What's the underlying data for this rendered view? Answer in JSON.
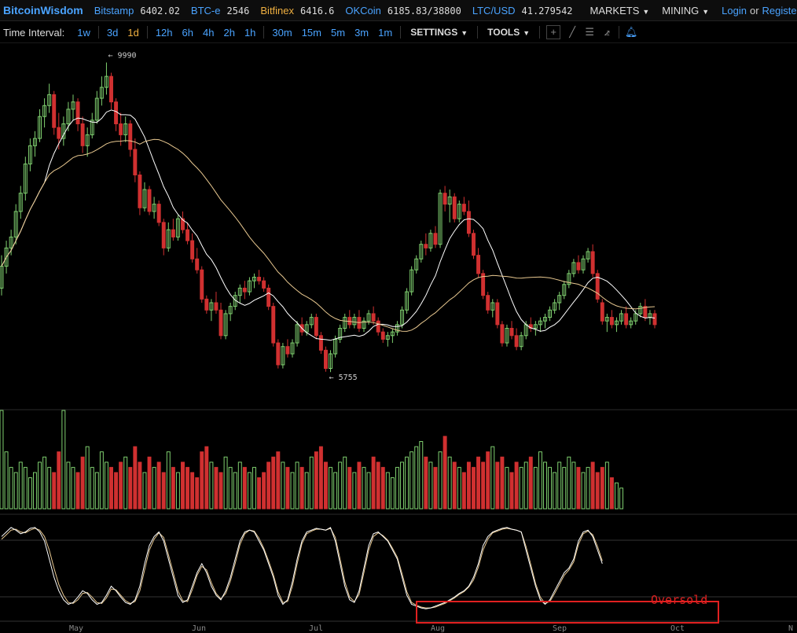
{
  "header": {
    "brand": "BitcoinWisdom",
    "exchanges": [
      {
        "name": "Bitstamp",
        "price": "6402.02",
        "highlight": false
      },
      {
        "name": "BTC-e",
        "price": "2546",
        "highlight": false
      },
      {
        "name": "Bitfinex",
        "price": "6416.6",
        "highlight": true
      },
      {
        "name": "OKCoin",
        "price": "6185.83/38800",
        "highlight": false
      },
      {
        "name": "LTC/USD",
        "price": "41.279542",
        "highlight": false
      }
    ],
    "markets_label": "MARKETS",
    "mining_label": "MINING",
    "login_label": "Login",
    "or_label": "or",
    "register_label": "Register"
  },
  "toolbar": {
    "time_interval_label": "Time Interval:",
    "intervals": [
      {
        "label": "1w",
        "active": false
      },
      {
        "label": "3d",
        "active": false
      },
      {
        "label": "1d",
        "active": true
      },
      {
        "label": "12h",
        "active": false
      },
      {
        "label": "6h",
        "active": false
      },
      {
        "label": "4h",
        "active": false
      },
      {
        "label": "2h",
        "active": false
      },
      {
        "label": "1h",
        "active": false
      },
      {
        "label": "30m",
        "active": false
      },
      {
        "label": "15m",
        "active": false
      },
      {
        "label": "5m",
        "active": false
      },
      {
        "label": "3m",
        "active": false
      },
      {
        "label": "1m",
        "active": false
      }
    ],
    "settings_label": "SETTINGS",
    "tools_label": "TOOLS",
    "tool_icons": [
      "crosshair-icon",
      "line-icon",
      "horizontal-lines-icon",
      "fan-icon",
      "alert-bell-icon"
    ]
  },
  "chart_data": {
    "type": "candlestick",
    "x_tick_labels": [
      "May",
      "Jun",
      "Jul",
      "Aug",
      "Sep",
      "Oct",
      "N"
    ],
    "annotations": {
      "high": "← 9990",
      "low": "← 5755",
      "oversold": "Oversold"
    },
    "price_range": [
      5300,
      10200
    ],
    "high_value": 9990,
    "low_value": 5755,
    "colors": {
      "up": "#7fcf6f",
      "down": "#d03030",
      "ma_fast": "#ffffff",
      "ma_slow": "#e8c890",
      "box": "#e02020"
    },
    "candles_ohlc": [
      [
        6900,
        7350,
        6800,
        7200
      ],
      [
        7200,
        7550,
        7100,
        7450
      ],
      [
        7450,
        7700,
        7350,
        7600
      ],
      [
        7600,
        8050,
        7500,
        7950
      ],
      [
        7950,
        8300,
        7850,
        8200
      ],
      [
        8200,
        8700,
        8100,
        8600
      ],
      [
        8600,
        8950,
        8500,
        8850
      ],
      [
        8850,
        9050,
        8700,
        8950
      ],
      [
        8950,
        9350,
        8900,
        9250
      ],
      [
        9250,
        9500,
        9100,
        9400
      ],
      [
        9400,
        9700,
        9300,
        9550
      ],
      [
        9550,
        9600,
        9000,
        9100
      ],
      [
        9100,
        9300,
        8800,
        8950
      ],
      [
        8950,
        9250,
        8850,
        9150
      ],
      [
        9150,
        9450,
        9050,
        9350
      ],
      [
        9350,
        9550,
        9200,
        9450
      ],
      [
        9450,
        9500,
        9050,
        9150
      ],
      [
        9150,
        9250,
        8750,
        8850
      ],
      [
        8850,
        9100,
        8700,
        9000
      ],
      [
        9000,
        9300,
        8950,
        9200
      ],
      [
        9200,
        9600,
        9150,
        9500
      ],
      [
        9500,
        9800,
        9400,
        9650
      ],
      [
        9650,
        9990,
        9550,
        9800
      ],
      [
        9800,
        9850,
        9350,
        9450
      ],
      [
        9450,
        9500,
        9050,
        9150
      ],
      [
        9150,
        9300,
        8850,
        9000
      ],
      [
        9000,
        9250,
        8900,
        9150
      ],
      [
        9150,
        9200,
        8700,
        8800
      ],
      [
        8800,
        8950,
        8350,
        8450
      ],
      [
        8450,
        8500,
        7900,
        8000
      ],
      [
        8000,
        8350,
        7950,
        8250
      ],
      [
        8250,
        8300,
        7900,
        7950
      ],
      [
        7950,
        8150,
        7850,
        8050
      ],
      [
        8050,
        8100,
        7750,
        7800
      ],
      [
        7800,
        7850,
        7350,
        7450
      ],
      [
        7450,
        7800,
        7400,
        7700
      ],
      [
        7700,
        7850,
        7550,
        7600
      ],
      [
        7600,
        7900,
        7550,
        7850
      ],
      [
        7850,
        7950,
        7650,
        7700
      ],
      [
        7700,
        7800,
        7500,
        7550
      ],
      [
        7550,
        7650,
        7250,
        7300
      ],
      [
        7300,
        7450,
        7100,
        7150
      ],
      [
        7150,
        7200,
        6700,
        6750
      ],
      [
        6750,
        6800,
        6550,
        6600
      ],
      [
        6600,
        6750,
        6450,
        6700
      ],
      [
        6700,
        6850,
        6550,
        6600
      ],
      [
        6600,
        6700,
        6200,
        6250
      ],
      [
        6250,
        6600,
        6200,
        6550
      ],
      [
        6550,
        6700,
        6450,
        6650
      ],
      [
        6650,
        6850,
        6600,
        6800
      ],
      [
        6800,
        6950,
        6700,
        6900
      ],
      [
        6900,
        7000,
        6750,
        6850
      ],
      [
        6850,
        7050,
        6800,
        7000
      ],
      [
        7000,
        7100,
        6900,
        7050
      ],
      [
        7050,
        7150,
        6950,
        7000
      ],
      [
        7000,
        7050,
        6850,
        6900
      ],
      [
        6900,
        6950,
        6600,
        6650
      ],
      [
        6650,
        6700,
        6100,
        6150
      ],
      [
        6150,
        6200,
        5800,
        5850
      ],
      [
        5850,
        6150,
        5800,
        6100
      ],
      [
        6100,
        6200,
        5950,
        6000
      ],
      [
        6000,
        6200,
        5950,
        6150
      ],
      [
        6150,
        6450,
        6100,
        6400
      ],
      [
        6400,
        6500,
        6250,
        6300
      ],
      [
        6300,
        6450,
        6250,
        6400
      ],
      [
        6400,
        6550,
        6350,
        6500
      ],
      [
        6500,
        6550,
        6200,
        6250
      ],
      [
        6250,
        6300,
        6000,
        6050
      ],
      [
        6050,
        6100,
        5755,
        5800
      ],
      [
        5800,
        6050,
        5750,
        6000
      ],
      [
        6000,
        6250,
        5950,
        6200
      ],
      [
        6200,
        6400,
        6150,
        6350
      ],
      [
        6350,
        6550,
        6300,
        6500
      ],
      [
        6500,
        6600,
        6350,
        6400
      ],
      [
        6400,
        6550,
        6350,
        6500
      ],
      [
        6500,
        6600,
        6300,
        6350
      ],
      [
        6350,
        6500,
        6300,
        6450
      ],
      [
        6450,
        6600,
        6400,
        6550
      ],
      [
        6550,
        6650,
        6400,
        6450
      ],
      [
        6450,
        6500,
        6250,
        6300
      ],
      [
        6300,
        6350,
        6150,
        6200
      ],
      [
        6200,
        6300,
        6100,
        6250
      ],
      [
        6250,
        6350,
        6150,
        6300
      ],
      [
        6300,
        6450,
        6250,
        6400
      ],
      [
        6400,
        6650,
        6350,
        6600
      ],
      [
        6600,
        6900,
        6550,
        6850
      ],
      [
        6850,
        7200,
        6800,
        7150
      ],
      [
        7150,
        7350,
        7100,
        7300
      ],
      [
        7300,
        7550,
        7250,
        7500
      ],
      [
        7500,
        7650,
        7350,
        7450
      ],
      [
        7450,
        7700,
        7400,
        7650
      ],
      [
        7650,
        7750,
        7450,
        7500
      ],
      [
        7500,
        8250,
        7450,
        8200
      ],
      [
        8200,
        8300,
        7950,
        8050
      ],
      [
        8050,
        8250,
        7800,
        8150
      ],
      [
        8150,
        8200,
        7800,
        7850
      ],
      [
        7850,
        8100,
        7800,
        8050
      ],
      [
        8050,
        8150,
        7900,
        7950
      ],
      [
        7950,
        8100,
        7600,
        7650
      ],
      [
        7650,
        7700,
        7300,
        7350
      ],
      [
        7350,
        7450,
        7050,
        7100
      ],
      [
        7100,
        7150,
        6750,
        6800
      ],
      [
        6800,
        6850,
        6550,
        6600
      ],
      [
        6600,
        6750,
        6500,
        6700
      ],
      [
        6700,
        6750,
        6350,
        6400
      ],
      [
        6400,
        6450,
        6100,
        6150
      ],
      [
        6150,
        6400,
        6100,
        6350
      ],
      [
        6350,
        6450,
        6200,
        6250
      ],
      [
        6250,
        6350,
        6050,
        6100
      ],
      [
        6100,
        6300,
        6050,
        6250
      ],
      [
        6250,
        6450,
        6200,
        6400
      ],
      [
        6400,
        6500,
        6300,
        6350
      ],
      [
        6350,
        6450,
        6250,
        6400
      ],
      [
        6400,
        6500,
        6300,
        6450
      ],
      [
        6450,
        6550,
        6350,
        6500
      ],
      [
        6500,
        6650,
        6450,
        6600
      ],
      [
        6600,
        6750,
        6550,
        6700
      ],
      [
        6700,
        6850,
        6600,
        6800
      ],
      [
        6800,
        7000,
        6750,
        6950
      ],
      [
        6950,
        7150,
        6900,
        7100
      ],
      [
        7100,
        7300,
        7050,
        7250
      ],
      [
        7250,
        7350,
        7100,
        7150
      ],
      [
        7150,
        7350,
        7100,
        7300
      ],
      [
        7300,
        7450,
        7250,
        7400
      ],
      [
        7400,
        7500,
        7050,
        7100
      ],
      [
        7100,
        7150,
        6700,
        6750
      ],
      [
        6700,
        6750,
        6400,
        6450
      ],
      [
        6450,
        6550,
        6300,
        6500
      ],
      [
        6500,
        6600,
        6350,
        6400
      ],
      [
        6400,
        6500,
        6300,
        6450
      ],
      [
        6450,
        6600,
        6400,
        6550
      ],
      [
        6550,
        6650,
        6350,
        6400
      ],
      [
        6400,
        6500,
        6350,
        6450
      ],
      [
        6450,
        6600,
        6400,
        6550
      ],
      [
        6550,
        6700,
        6500,
        6650
      ],
      [
        6650,
        6750,
        6450,
        6500
      ],
      [
        6500,
        6600,
        6400,
        6550
      ],
      [
        6550,
        6600,
        6350,
        6400
      ]
    ],
    "volume": [
      95,
      55,
      40,
      35,
      45,
      40,
      30,
      35,
      45,
      50,
      40,
      35,
      55,
      95,
      45,
      40,
      35,
      50,
      60,
      40,
      35,
      55,
      45,
      40,
      35,
      45,
      50,
      40,
      60,
      45,
      35,
      50,
      40,
      45,
      35,
      55,
      40,
      35,
      45,
      40,
      35,
      30,
      55,
      60,
      45,
      40,
      35,
      50,
      40,
      35,
      45,
      40,
      35,
      40,
      30,
      35,
      45,
      50,
      55,
      45,
      40,
      35,
      45,
      40,
      35,
      50,
      55,
      60,
      45,
      40,
      35,
      45,
      50,
      40,
      35,
      45,
      40,
      35,
      50,
      45,
      40,
      35,
      30,
      40,
      45,
      50,
      55,
      60,
      65,
      50,
      45,
      40,
      55,
      70,
      50,
      45,
      40,
      35,
      45,
      40,
      50,
      45,
      55,
      60,
      45,
      50,
      40,
      35,
      45,
      40,
      45,
      50,
      40,
      55,
      45,
      40,
      35,
      45,
      40,
      50,
      45,
      40,
      35,
      40,
      45,
      35,
      40,
      45,
      30,
      25,
      20
    ],
    "stoch_k": [
      85,
      90,
      95,
      92,
      88,
      90,
      94,
      95,
      90,
      80,
      60,
      40,
      25,
      15,
      10,
      12,
      18,
      25,
      22,
      15,
      10,
      12,
      20,
      30,
      25,
      18,
      12,
      10,
      15,
      30,
      55,
      75,
      85,
      90,
      80,
      60,
      40,
      20,
      12,
      15,
      30,
      45,
      55,
      45,
      30,
      20,
      15,
      25,
      40,
      60,
      80,
      90,
      92,
      90,
      80,
      70,
      55,
      40,
      20,
      10,
      15,
      35,
      60,
      80,
      90,
      92,
      94,
      93,
      92,
      95,
      80,
      55,
      30,
      15,
      12,
      25,
      50,
      75,
      88,
      90,
      85,
      80,
      70,
      60,
      40,
      20,
      10,
      8,
      6,
      5,
      6,
      8,
      10,
      12,
      15,
      18,
      22,
      25,
      30,
      40,
      55,
      75,
      85,
      90,
      92,
      94,
      95,
      93,
      92,
      90,
      70,
      50,
      30,
      15,
      10,
      15,
      25,
      35,
      45,
      50,
      60,
      80,
      90,
      92,
      85,
      70,
      55
    ],
    "stoch_d": [
      82,
      87,
      92,
      93,
      90,
      89,
      92,
      94,
      92,
      85,
      70,
      50,
      32,
      20,
      12,
      11,
      15,
      22,
      23,
      18,
      12,
      11,
      17,
      27,
      26,
      20,
      14,
      11,
      13,
      25,
      48,
      70,
      82,
      89,
      84,
      65,
      45,
      25,
      14,
      13,
      26,
      42,
      52,
      48,
      34,
      22,
      16,
      22,
      36,
      55,
      76,
      88,
      92,
      91,
      83,
      72,
      58,
      43,
      24,
      12,
      13,
      30,
      55,
      77,
      88,
      91,
      93,
      93,
      92,
      94,
      84,
      60,
      35,
      18,
      13,
      21,
      45,
      70,
      85,
      89,
      86,
      81,
      72,
      62,
      44,
      24,
      12,
      9,
      7,
      6,
      6,
      7,
      9,
      11,
      14,
      17,
      21,
      24,
      29,
      37,
      51,
      70,
      82,
      89,
      91,
      93,
      94,
      93,
      92,
      90,
      74,
      54,
      33,
      18,
      11,
      13,
      22,
      32,
      42,
      48,
      57,
      76,
      88,
      91,
      87,
      74,
      58
    ]
  }
}
